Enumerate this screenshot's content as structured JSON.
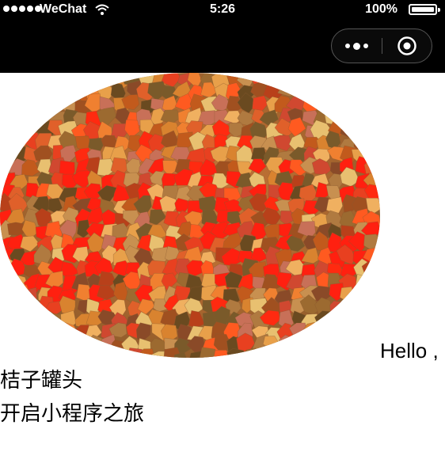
{
  "status_bar": {
    "carrier": "WeChat",
    "time": "5:26",
    "battery": "100%"
  },
  "nav": {
    "more_icon": "more-dots-icon",
    "close_icon": "target-circle-icon"
  },
  "main": {
    "hello_text": "Hello ,",
    "line1": "桔子罐头",
    "line2": "开启小程序之旅"
  },
  "colors": {
    "status_bar_bg": "#000000",
    "page_bg": "#ffffff"
  }
}
